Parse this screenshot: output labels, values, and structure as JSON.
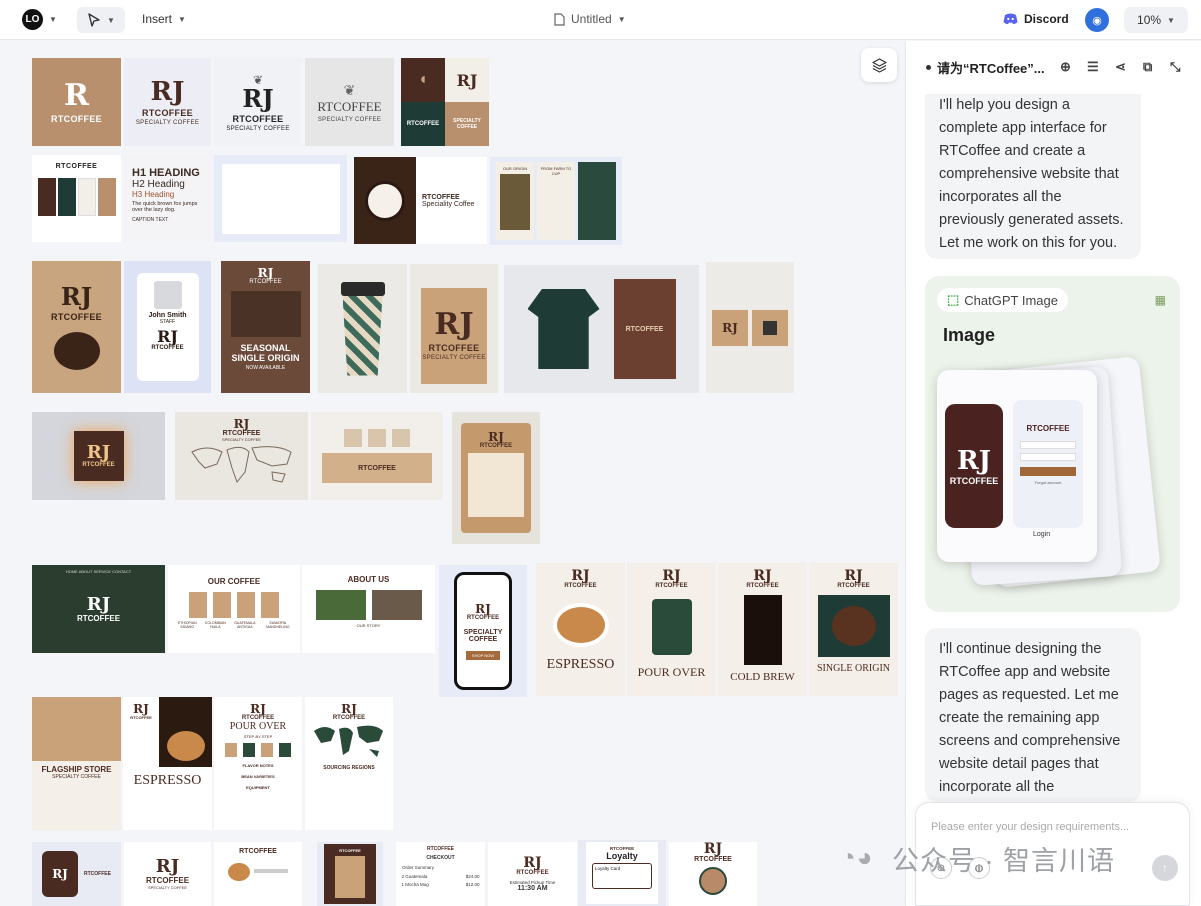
{
  "topbar": {
    "logo": "LO",
    "insert_label": "Insert",
    "doc_title": "Untitled",
    "discord_label": "Discord",
    "zoom": "10%"
  },
  "canvas": {
    "row1": {
      "logo_kraft": {
        "mark": "R",
        "name": "RTCOFFEE"
      },
      "logo_light": {
        "mark": "RJ",
        "name": "RTCOFFEE",
        "sub": "SPECIALTY COFFEE"
      },
      "logo_leaf": {
        "mark": "RJ",
        "name": "RTCOFFEE",
        "sub": "SPECIALTY COFFEE"
      },
      "logo_serif": {
        "name": "RTCOFFEE",
        "sub": "SPECIALTY COFFEE"
      },
      "logo_grid": {
        "mark": "RJ",
        "name": "RTCOFFEE",
        "name2": "SPECIALTY COFFEE"
      }
    },
    "row2": {
      "palette_title": "RTCOFFEE",
      "type_h1": "H1 HEADING",
      "type_h2": "H2 Heading",
      "type_h3": "H3 Heading",
      "type_body": "The quick brown fox jumps over the lazy dog.",
      "type_caption": "CAPTION TEXT",
      "mug_brand": "RTCOFFEE",
      "mug_line": "Speciality Coffee",
      "origin_label": "OUR ORIGIN",
      "origin_label2": "FROM FARM TO CUP"
    },
    "row3": {
      "bag": {
        "mark": "RJ",
        "name": "RTCOFFEE"
      },
      "badge": {
        "person": "John Smith",
        "role": "STAFF",
        "mark": "RJ",
        "name": "RTCOFFEE"
      },
      "poster": {
        "mark": "RJ",
        "name": "RTCOFFEE",
        "line1": "SEASONAL",
        "line2": "SINGLE ORIGIN",
        "line3": "NOW AVAILABLE"
      },
      "shopping_bag": {
        "mark": "RJ",
        "name": "RTCOFFEE",
        "sub": "SPECIALTY COFFEE"
      },
      "apron": {
        "name": "RTCOFFEE"
      },
      "card": {
        "mark": "RJ"
      }
    },
    "row4": {
      "sign_name": "RTCOFFEE",
      "map_name": "RTCOFFEE",
      "map_sub": "SPECIALTY COFFEE",
      "store_name": "RTCOFFEE",
      "menu_name": "RTCOFFEE"
    },
    "row5": {
      "hero_name": "RTCOFFEE",
      "hero_nav": "HOME  ABOUT  SERVICE  CONTACT",
      "shop_title": "OUR COFFEE",
      "shop_items": [
        "ETHIOPIAN SIDAMO",
        "COLOMBIAN HUILA",
        "GUATEMALA ANTIGUA",
        "SUMATRA MANDHELING"
      ],
      "about_title": "ABOUT US",
      "about_story": "OUR STORY",
      "phone_name": "RTCOFFEE",
      "phone_tag1": "SPECIALTY",
      "phone_tag2": "COFFEE",
      "phone_btn": "SHOP NOW",
      "espresso": "ESPRESSO",
      "pour_over": "POUR OVER",
      "cold_brew": "COLD BREW",
      "single_origin": "SINGLE ORIGIN",
      "brand": "RTCOFFEE"
    },
    "row6": {
      "flagship_title": "FLAGSHIP STORE",
      "flagship_sub": "SPECIALTY COFFEE",
      "espresso_title": "ESPRESSO",
      "espresso_brand": "RTCOFFEE",
      "pour_brand": "RTCOFFEE",
      "pour_title": "POUR OVER",
      "pour_sub": "STEP-BY-STEP",
      "pour_notes": "FLAVOR NOTES",
      "pour_varieties": "BEAN VARIETIES",
      "pour_equipment": "EQUIPMENT",
      "regions_brand": "RTCOFFEE",
      "regions_title": "SOURCING REGIONS"
    },
    "row7": {
      "app1_name": "RTCOFFEE",
      "app2_name": "RTCOFFEE",
      "app2_sub": "SPECIALTY COFFEE",
      "app3_name": "RTCOFFEE",
      "app4_name": "RTCOFFEE",
      "checkout_brand": "RTCOFFEE",
      "checkout_title": "CHECKOUT",
      "checkout_summary": "Order Summary",
      "checkout_item1": "2 Guatemala",
      "checkout_price1": "$24.00",
      "checkout_item2": "1 Mocha Mug",
      "checkout_price2": "$12.00",
      "pickup_brand": "RTCOFFEE",
      "pickup_label": "Estimated Pickup Time",
      "pickup_time": "11:30 AM",
      "loyalty_brand": "RTCOFFEE",
      "loyalty_title": "Loyalty",
      "loyalty_card": "Loyalty Card",
      "profile_brand": "RTCOFFEE"
    }
  },
  "panel": {
    "title": "请为“RTCoffee”...",
    "msg1": "I'll help you design a complete app interface for RTCoffee and create a comprehensive website that incorporates all the previously generated assets. Let me work on this for you.",
    "chip_label": "ChatGPT Image",
    "card_label": "Image",
    "mock_name": "RTCOFFEE",
    "mock_login": "Login",
    "mock_forgot": "Forgot account",
    "msg2": "I'll continue designing the RTCoffee app and website pages as requested. Let me create the remaining app screens and comprehensive website detail pages that incorporate all the",
    "input_placeholder": "Please enter your design requirements..."
  },
  "watermark": "公众号 · 智言川语"
}
